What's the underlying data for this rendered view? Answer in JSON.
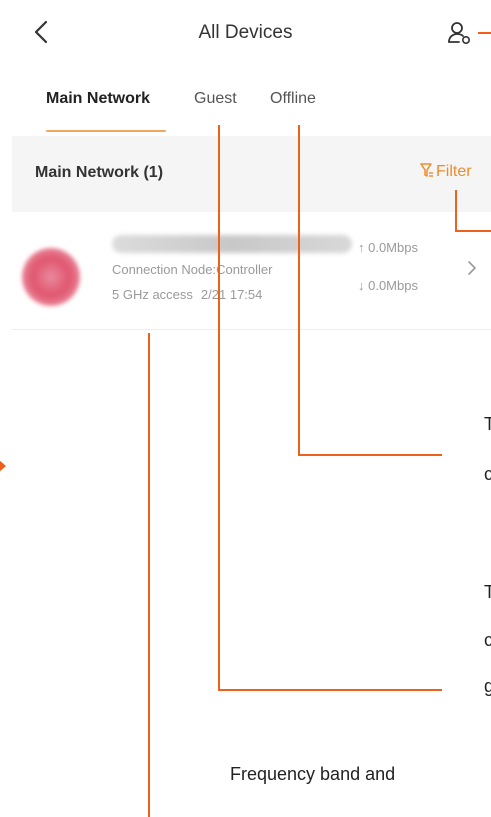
{
  "header": {
    "title": "All Devices",
    "back_icon": "chevron-left-icon",
    "user_icon": "user-settings-icon"
  },
  "tabs": [
    {
      "label": "Main Network",
      "active": true
    },
    {
      "label": "Guest",
      "active": false
    },
    {
      "label": "Offline",
      "active": false
    }
  ],
  "section": {
    "title": "Main Network (1)",
    "filter_label": "Filter",
    "filter_icon": "filter-icon"
  },
  "device": {
    "connection_node": "Connection Node:Controller",
    "band": "5 GHz access",
    "time": "2/21 17:54",
    "upload": "↑ 0.0Mbps",
    "download": "↓ 0.0Mbps"
  },
  "annotations": {
    "offline_text": "T",
    "offline_text_2": "c",
    "guest_text": "T",
    "guest_text_2": "c",
    "guest_text_3": "g",
    "band_text": "Frequency band and"
  },
  "colors": {
    "accent": "#f08b2a",
    "annotation_line": "#f0601d",
    "underline": "#f3a75e"
  }
}
